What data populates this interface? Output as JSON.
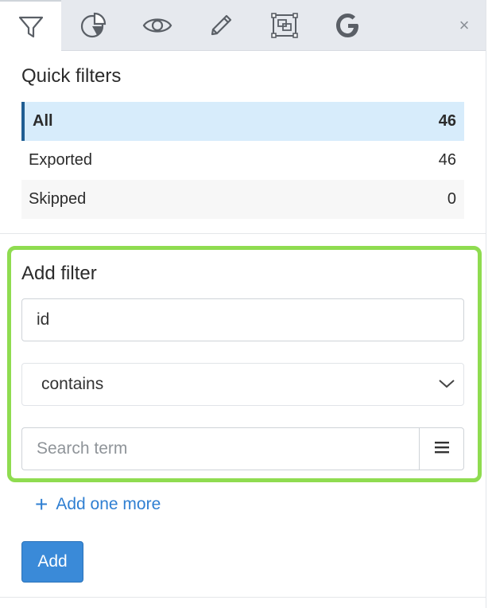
{
  "tabs": [
    {
      "icon": "filter-icon",
      "active": true
    },
    {
      "icon": "pie-chart-icon",
      "active": false
    },
    {
      "icon": "eye-icon",
      "active": false
    },
    {
      "icon": "pencil-icon",
      "active": false
    },
    {
      "icon": "image-region-icon",
      "active": false
    },
    {
      "icon": "google-icon",
      "active": false
    }
  ],
  "close_label": "×",
  "quick_filters": {
    "title": "Quick filters",
    "items": [
      {
        "label": "All",
        "count": "46"
      },
      {
        "label": "Exported",
        "count": "46"
      },
      {
        "label": "Skipped",
        "count": "0"
      }
    ]
  },
  "add_filter": {
    "title": "Add filter",
    "field_value": "id",
    "operator": "contains",
    "search_placeholder": "Search term",
    "add_more_label": "Add one more",
    "add_button_label": "Add"
  },
  "colors": {
    "highlight_border": "#8fdc50",
    "active_row_bg": "#d7ecfb",
    "active_row_bar": "#1f5e93",
    "link": "#2f7fd2",
    "primary_button": "#3a8ad8"
  }
}
